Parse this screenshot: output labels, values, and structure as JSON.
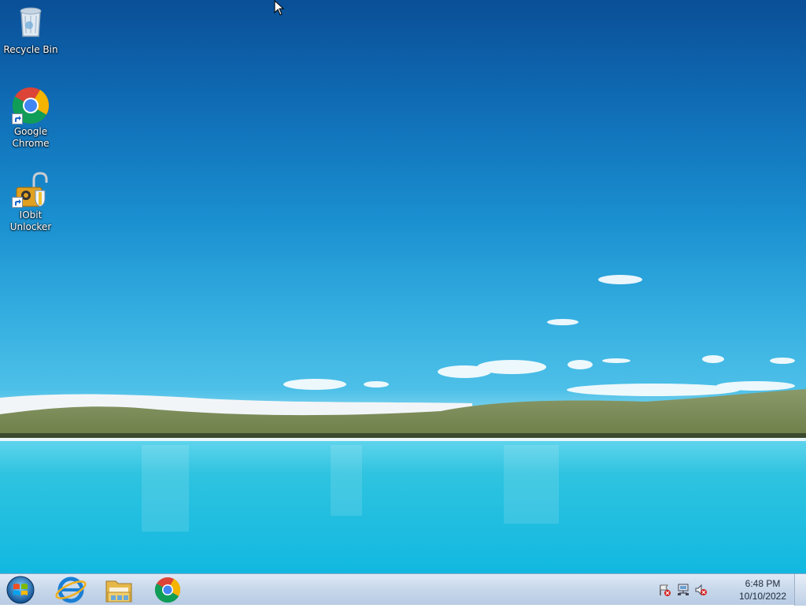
{
  "desktop": {
    "icons": [
      {
        "label": "Recycle Bin",
        "icon": "recycle-bin-icon"
      },
      {
        "label": "Google\nChrome",
        "icon": "chrome-icon"
      },
      {
        "label": "IObit\nUnlocker",
        "icon": "iobit-unlocker-icon"
      }
    ]
  },
  "taskbar": {
    "pinned": [
      {
        "name": "internet-explorer",
        "icon": "internet-explorer-icon"
      },
      {
        "name": "windows-explorer",
        "icon": "folder-icon"
      },
      {
        "name": "google-chrome",
        "icon": "chrome-icon"
      }
    ],
    "tray": {
      "icons": [
        "action-center-flag-icon",
        "network-icon",
        "volume-muted-icon"
      ],
      "time": "6:48 PM",
      "date": "10/10/2022"
    }
  },
  "colors": {
    "sky_top": "#0a4f97",
    "sky_mid": "#1a8fd0",
    "water": "#2ec3e0",
    "taskbar": "#c9d9ec"
  }
}
